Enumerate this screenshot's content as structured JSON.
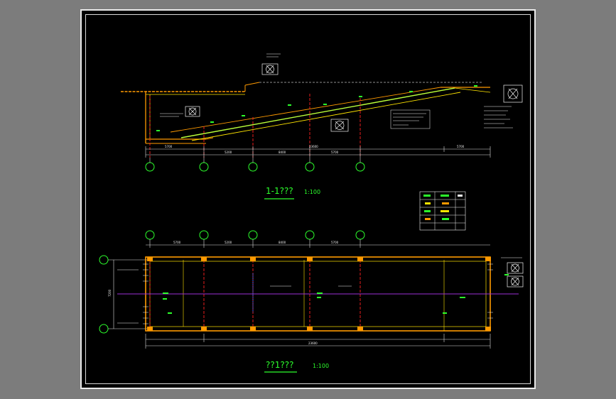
{
  "section_view": {
    "title": "1-1???",
    "scale": "1:100",
    "grid_count": 5,
    "dims_top": [
      "5700",
      "5200",
      "8400",
      "5700",
      "5700"
    ],
    "dims_total": "23600"
  },
  "plan_view": {
    "title": "??1???",
    "scale": "1:100",
    "dims_top": [
      "5700",
      "5200",
      "8400",
      "5700"
    ],
    "dims_total": "23600",
    "left_dim": "7200"
  },
  "colors": {
    "background": "#000000",
    "frame": "#e8e8e8",
    "wall": "#ff9a00",
    "slab": "#ffe400",
    "slope": "#b9ff3a",
    "grid": "#ff1e1e",
    "axis": "#9b2fd6",
    "text_green": "#2cff2c",
    "text_white": "#f2f2f2",
    "dim": "#e0e0e0"
  }
}
